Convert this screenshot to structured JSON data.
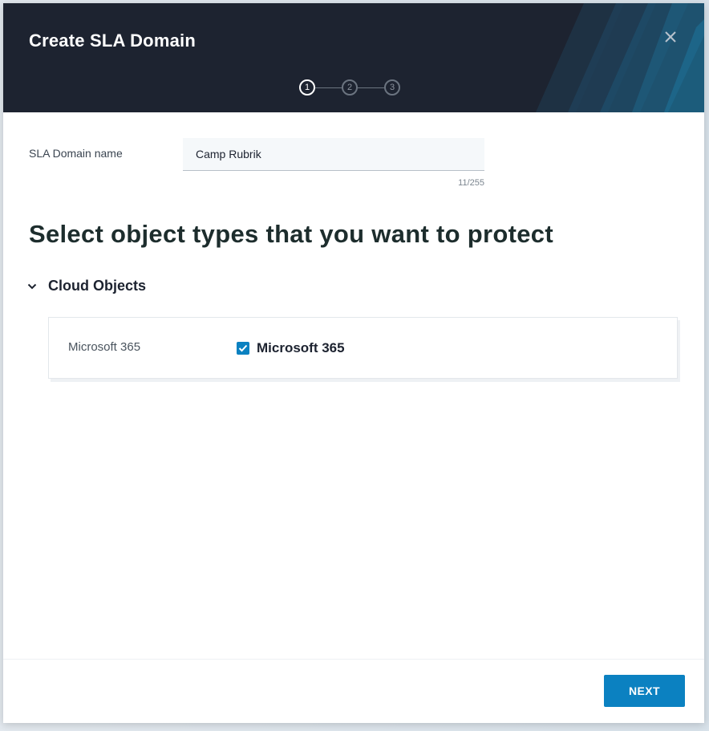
{
  "dialog": {
    "title": "Create SLA Domain",
    "close_icon": "close-icon"
  },
  "stepper": {
    "steps": [
      "1",
      "2",
      "3"
    ],
    "current_step": 1
  },
  "form": {
    "name_label": "SLA Domain name",
    "name_value": "Camp Rubrik",
    "char_count": "11/255"
  },
  "section": {
    "heading": "Select object types that you want to protect"
  },
  "groups": [
    {
      "label": "Cloud Objects",
      "expanded": true,
      "items": [
        {
          "label": "Microsoft 365",
          "option_label": "Microsoft 365",
          "checked": true
        }
      ]
    }
  ],
  "footer": {
    "next_label": "NEXT"
  },
  "colors": {
    "header_bg": "#1d2330",
    "accent": "#0b81c1"
  }
}
